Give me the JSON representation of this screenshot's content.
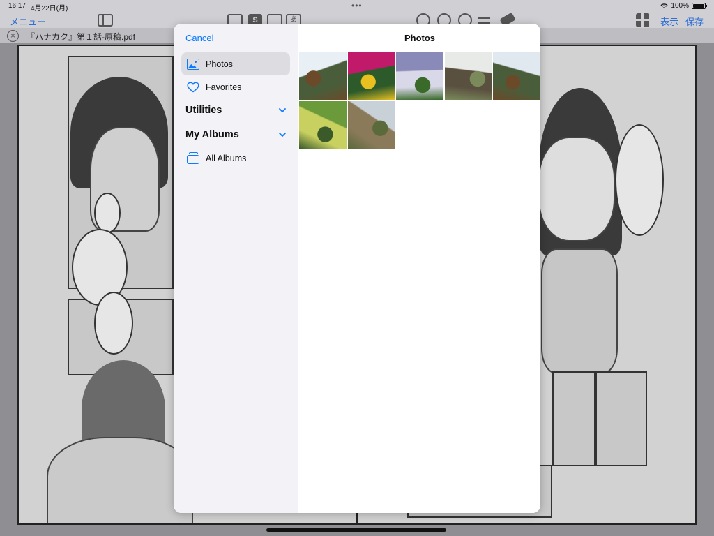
{
  "status_bar": {
    "time": "16:17",
    "date": "4月22日(月)",
    "battery": "100%"
  },
  "toolbar": {
    "menu_label": "メニュー",
    "view_label": "表示",
    "save_label": "保存",
    "a_icon_glyph": "あ",
    "s_icon_glyph": "S"
  },
  "file_bar": {
    "file_name": "『ハナカク』第１話-原稿.pdf",
    "close_glyph": "×"
  },
  "picker": {
    "cancel_label": "Cancel",
    "title": "Photos",
    "sidebar": {
      "photos_label": "Photos",
      "favorites_label": "Favorites",
      "utilities_label": "Utilities",
      "my_albums_label": "My Albums",
      "all_albums_label": "All Albums"
    },
    "photos": [
      {
        "name": "waterfall-coast",
        "colors": [
          "#e8eff5",
          "#4a5d3a",
          "#6b4a2a"
        ]
      },
      {
        "name": "pink-flowers",
        "colors": [
          "#c21a6a",
          "#2d5a2a",
          "#e8c020"
        ]
      },
      {
        "name": "large-waterfall",
        "colors": [
          "#8a8ab8",
          "#d8d8e8",
          "#3a6a2a"
        ]
      },
      {
        "name": "rocky-stream",
        "colors": [
          "#e8eae8",
          "#5a5040",
          "#7a8a5a"
        ]
      },
      {
        "name": "waterfall-coast-2",
        "colors": [
          "#e0e8f0",
          "#4a5d3a",
          "#6b4a2a"
        ]
      },
      {
        "name": "yellow-leaf",
        "colors": [
          "#6a9a3a",
          "#c8d060",
          "#3a5a2a"
        ]
      },
      {
        "name": "hillside-flowers",
        "colors": [
          "#c8d0d8",
          "#8a7a5a",
          "#5a6a3a"
        ]
      }
    ]
  },
  "colors": {
    "accent": "#0a7aff",
    "dim_toolbar_link": "#2f6fd6",
    "sidebar_bg": "#f2f2f7"
  }
}
